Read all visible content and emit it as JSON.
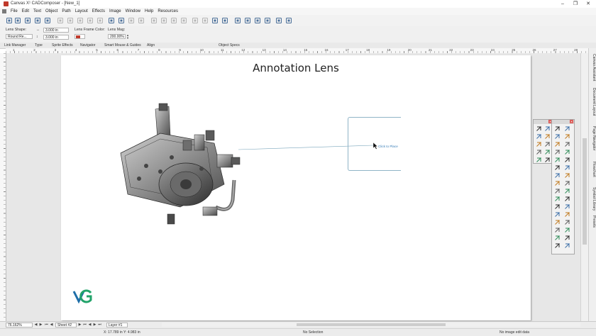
{
  "window": {
    "title": "Canvas X¹ CADComposer - [New_1]"
  },
  "menu": [
    "File",
    "Edit",
    "Text",
    "Object",
    "Path",
    "Layout",
    "Effects",
    "Image",
    "Window",
    "Help",
    "Resources"
  ],
  "toolbar_icons": [
    "new-icon",
    "open-icon",
    "save-icon",
    "print-icon",
    "print-preview-icon",
    "cut-icon",
    "copy-icon",
    "paste-icon",
    "paste-special-icon",
    "delete-icon",
    "undo-icon",
    "redo-icon",
    "bring-front-icon",
    "send-back-icon",
    "group-icon",
    "ungroup-icon",
    "lock-icon",
    "unlock-icon",
    "align-icon",
    "rotate-icon",
    "image-icon",
    "layers-icon",
    "link-icon",
    "text-icon",
    "web-icon",
    "table-icon",
    "chart-icon",
    "window-icon"
  ],
  "properties": {
    "lens_shape_label": "Lens Shape:",
    "lens_shape_value": "Round Re...",
    "width_value": "3.000 in",
    "height_value": "3.000 in",
    "frame_color_label": "Lens Frame Color:",
    "frame_color": "#c0392b",
    "mag_label": "Lens Mag:",
    "mag_value": "200.00%"
  },
  "panel_tabs": [
    "Link Manager",
    "Type",
    "Sprite Effects",
    "Navigator",
    "Smart Mouse & Guides",
    "Align",
    "Object Specs"
  ],
  "ruler_numbers": [
    "1",
    "2",
    "3",
    "4",
    "5",
    "6",
    "7",
    "8",
    "9",
    "10",
    "11",
    "12",
    "13",
    "14",
    "15",
    "16",
    "17",
    "18",
    "19",
    "20",
    "21",
    "22",
    "23",
    "24",
    "25",
    "26",
    "27",
    "28"
  ],
  "canvas": {
    "title": "Annotation Lens",
    "lens_hint": "Click to Place"
  },
  "right_dock_tabs": [
    "Canvas Assistant",
    "Document Layout",
    "Page Navigator",
    "Flowchart",
    "Symbol Library",
    "Presets"
  ],
  "status": {
    "zoom": "76.162%",
    "sheet": "Sheet #2",
    "layer": "Layer #1",
    "coords": "X: 17.789 in Y: 4.983 in",
    "selection": "No Selection",
    "image_info": "No image edit data"
  },
  "colors": {
    "accent": "#c0392b",
    "lens_frame": "#8fb4c7",
    "lens_text": "#3a7fb8"
  }
}
